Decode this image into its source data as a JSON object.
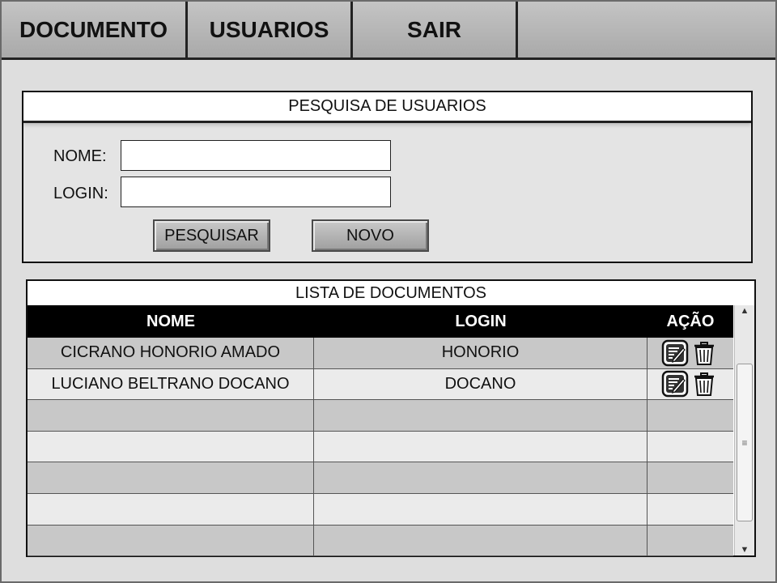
{
  "menu": {
    "items": [
      "DOCUMENTO",
      "USUARIOS",
      "SAIR"
    ]
  },
  "search": {
    "title": "PESQUISA DE USUARIOS",
    "name_label": "NOME:",
    "name_value": "",
    "login_label": "LOGIN:",
    "login_value": "",
    "search_button": "PESQUISAR",
    "new_button": "NOVO"
  },
  "list": {
    "title": "LISTA DE DOCUMENTOS",
    "columns": [
      "NOME",
      "LOGIN",
      "AÇÃO"
    ],
    "rows": [
      {
        "nome": "CICRANO HONORIO AMADO",
        "login": "HONORIO",
        "actions": [
          "edit-icon",
          "trash-icon"
        ]
      },
      {
        "nome": "LUCIANO BELTRANO DOCANO",
        "login": "DOCANO",
        "actions": [
          "edit-icon",
          "trash-icon"
        ]
      },
      {
        "nome": "",
        "login": "",
        "actions": []
      },
      {
        "nome": "",
        "login": "",
        "actions": []
      },
      {
        "nome": "",
        "login": "",
        "actions": []
      },
      {
        "nome": "",
        "login": "",
        "actions": []
      },
      {
        "nome": "",
        "login": "",
        "actions": []
      }
    ]
  },
  "scrollbar": {
    "up_glyph": "▲",
    "down_glyph": "▼",
    "thumb_glyph": "≡"
  },
  "colors": {
    "header_bg": "#000000",
    "row_odd": "#c8c8c8",
    "row_even": "#ebebeb",
    "menu_bg": "#b4b4b4"
  }
}
